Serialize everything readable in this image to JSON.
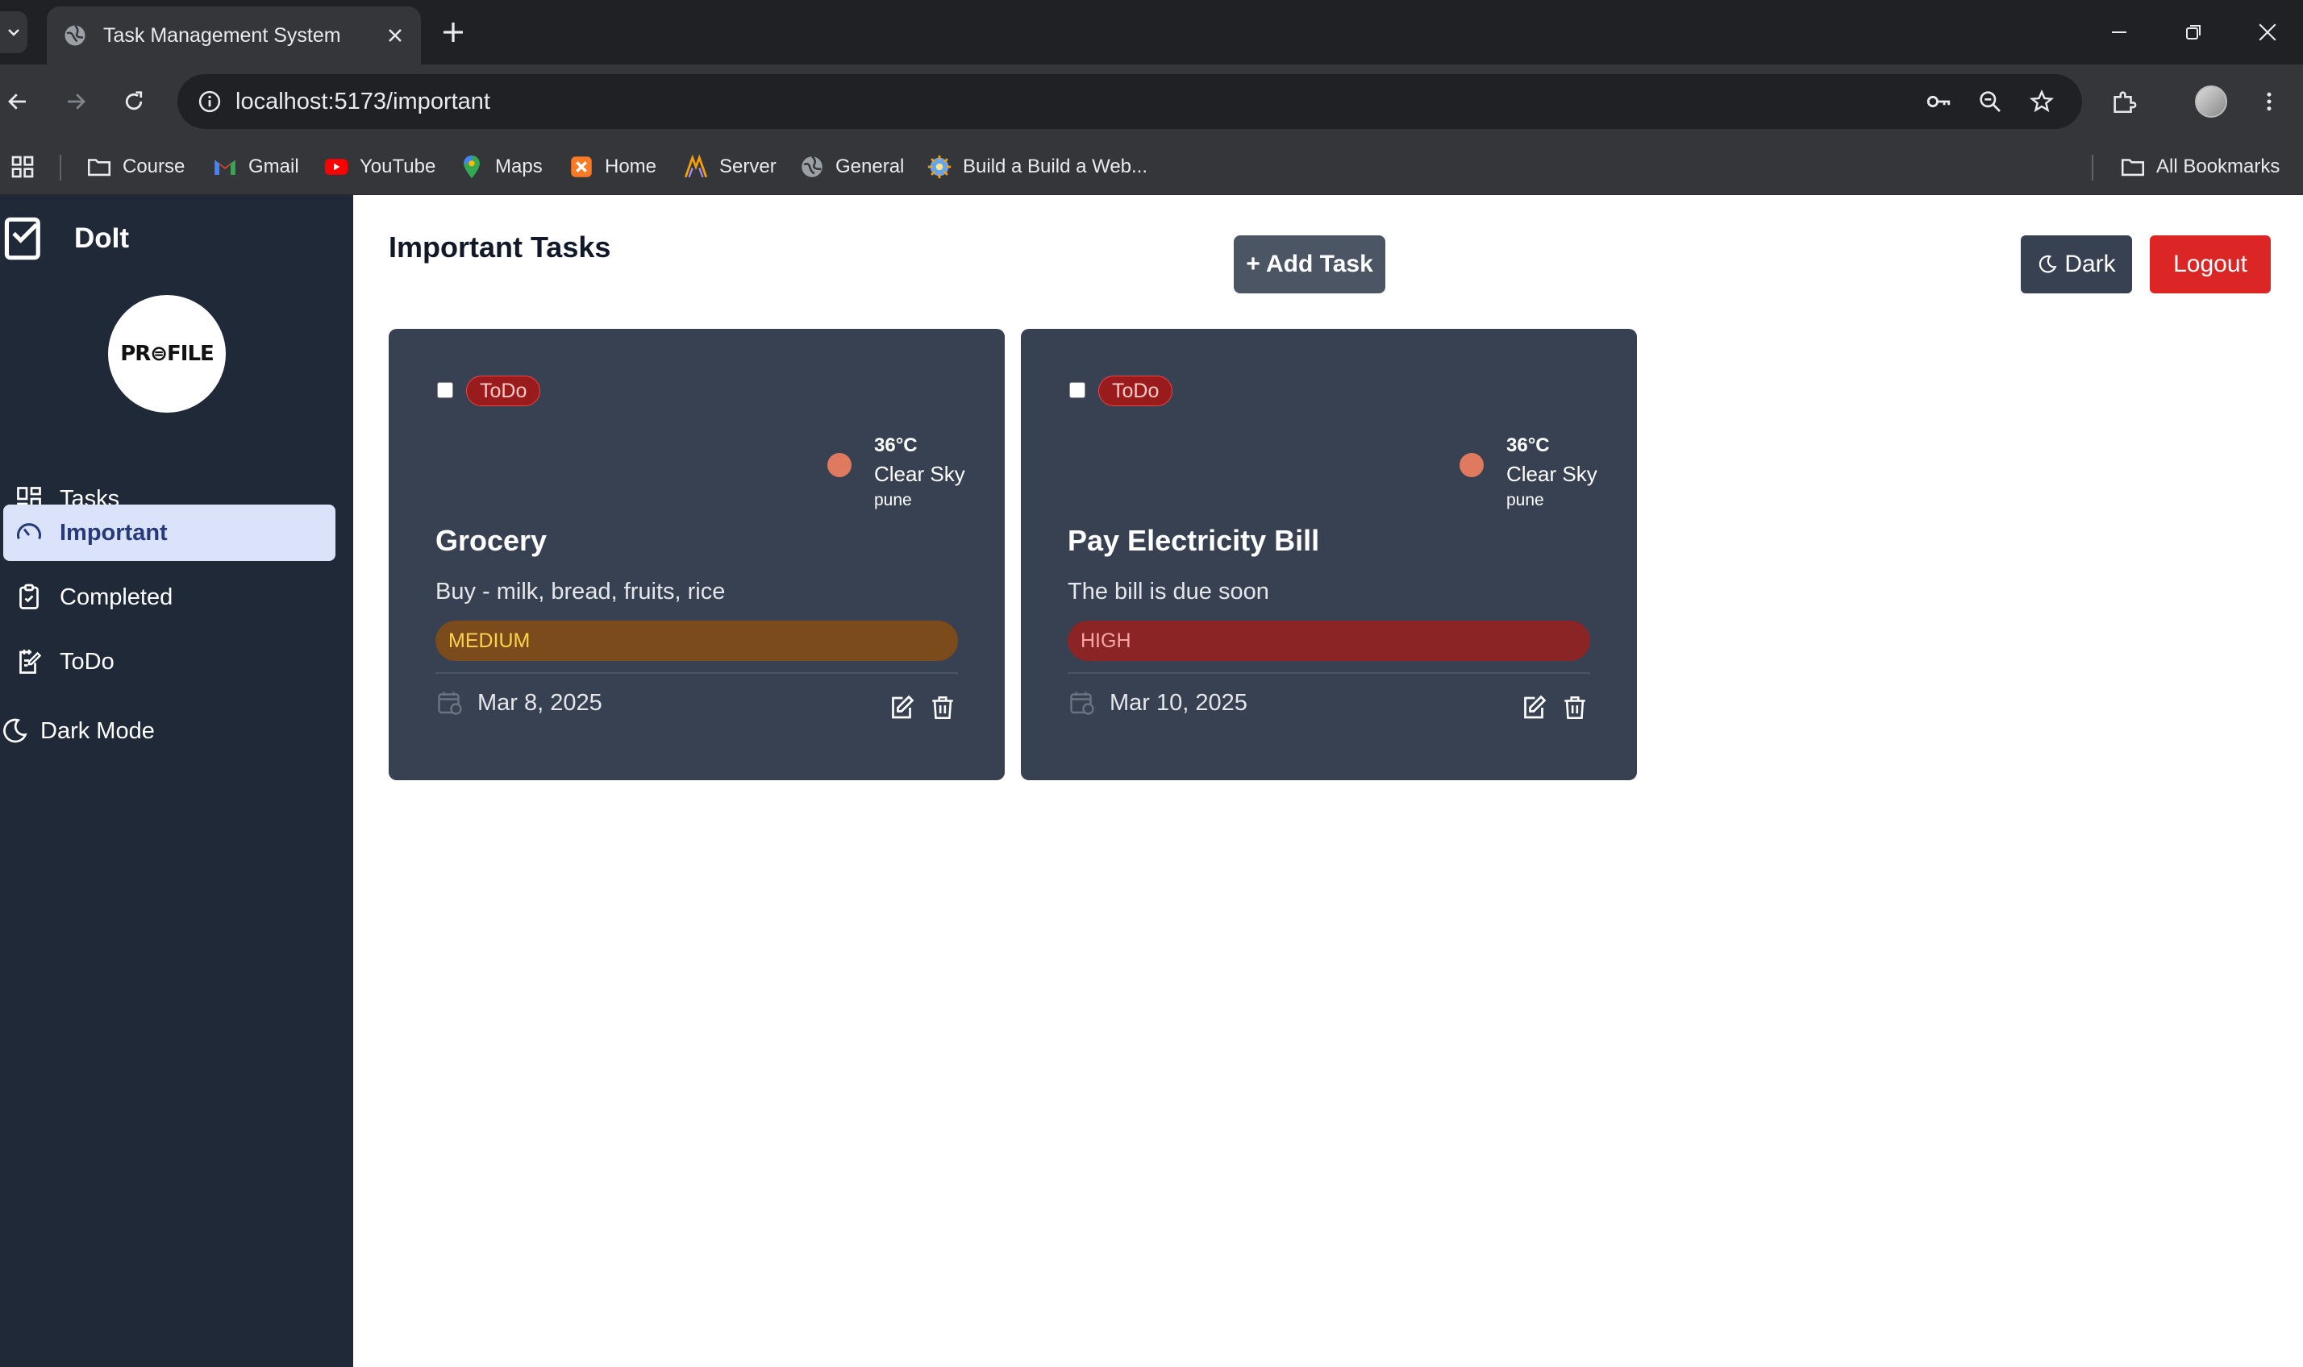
{
  "browser": {
    "tab_title": "Task Management System",
    "url": "localhost:5173/important",
    "bookmarks": [
      {
        "label": "Course",
        "icon": "folder-icon"
      },
      {
        "label": "Gmail",
        "icon": "gmail-icon"
      },
      {
        "label": "YouTube",
        "icon": "youtube-icon"
      },
      {
        "label": "Maps",
        "icon": "maps-icon"
      },
      {
        "label": "Home",
        "icon": "xampp-icon"
      },
      {
        "label": "Server",
        "icon": "server-icon"
      },
      {
        "label": "General",
        "icon": "globe-icon"
      },
      {
        "label": "Build a Build a Web...",
        "icon": "build-icon"
      }
    ],
    "all_bookmarks": "All Bookmarks"
  },
  "sidebar": {
    "brand": "DoIt",
    "profile_text": "PR⊜FILE",
    "items": [
      {
        "label": "Tasks",
        "icon": "grid-icon",
        "active": false
      },
      {
        "label": "Important",
        "icon": "gauge-icon",
        "active": true
      },
      {
        "label": "Completed",
        "icon": "clipboard-check-icon",
        "active": false
      },
      {
        "label": "ToDo",
        "icon": "notepad-edit-icon",
        "active": false
      }
    ],
    "dark_mode_label": "Dark Mode"
  },
  "header": {
    "title": "Important Tasks",
    "add_task_label": "+ Add Task",
    "dark_label": "Dark",
    "logout_label": "Logout"
  },
  "tasks": [
    {
      "status": "ToDo",
      "weather": {
        "temp": "36°C",
        "condition": "Clear Sky",
        "city": "pune"
      },
      "title": "Grocery",
      "description": "Buy - milk, bread, fruits, rice",
      "priority": "MEDIUM",
      "priority_bg": "#7c4b1c",
      "priority_fg": "#fcd34d",
      "date": "Mar 8, 2025"
    },
    {
      "status": "ToDo",
      "weather": {
        "temp": "36°C",
        "condition": "Clear Sky",
        "city": "pune"
      },
      "title": "Pay Electricity Bill",
      "description": "The bill is due soon",
      "priority": "HIGH",
      "priority_bg": "#8b2424",
      "priority_fg": "#fca5a5",
      "date": "Mar 10, 2025"
    }
  ],
  "colors": {
    "sidebar_bg": "#1f2937",
    "card_bg": "#374151",
    "active_item_bg": "#dbe3fb",
    "logout_bg": "#dc2626"
  }
}
